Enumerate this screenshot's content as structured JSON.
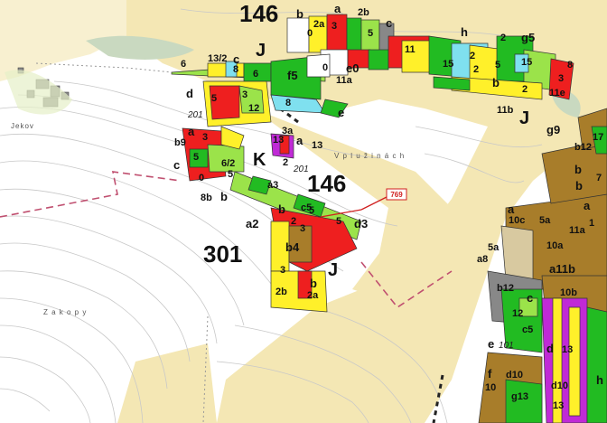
{
  "map": {
    "place_names": {
      "jekov": "Jekov",
      "zakopy": "Z a k o p y",
      "v_pluzinach": "V  p l u ž i n á c h"
    },
    "block_numbers": {
      "b146_top": "146",
      "b146_mid": "146",
      "b301": "301"
    },
    "zone_letters": {
      "j1": "J",
      "j2": "J",
      "j3": "J",
      "k": "K"
    },
    "callout": {
      "value": "769",
      "color": "#d02020"
    },
    "italic_codes": {
      "i201a": "201",
      "i201b": "201",
      "i101": "101"
    },
    "plot_labels": {
      "p_b_top": "b",
      "p_2a": "2a",
      "p_a_top": "a",
      "p_2b_top": "2b",
      "p_c_top": "c",
      "p_0": "0",
      "p_3_top": "3",
      "p_5_top": "5",
      "p_h": "h",
      "p_11": "11",
      "p_2_h": "2",
      "p_g5": "g5",
      "p_2_r": "2",
      "p_6_l": "6",
      "p_13_2": "13/2",
      "p_c_l": "c",
      "p_8_l": "8",
      "p_6_m": "6",
      "p_f5": "f5",
      "p_0_m": "0",
      "p_e0": "e0",
      "p_11a": "11a",
      "p_15a": "15",
      "p_5_r": "5",
      "p_2_r2": "2",
      "p_15b": "15",
      "p_8_r": "8",
      "p_3_r": "3",
      "p_b_r": "b",
      "p_11e": "11e",
      "p_2_r3": "2",
      "p_11b": "11b",
      "p_g9": "g9",
      "p_d_l": "d",
      "p_5_l": "5",
      "p_3_l": "3",
      "p_12": "12",
      "p_8_m": "8",
      "p_e_m": "e",
      "p_b9": "b9",
      "p_a_l": "a",
      "p_3_l2": "3",
      "p_5_l2": "5",
      "p_c_l2": "c",
      "p_6_2": "6/2",
      "p_0_l": "0",
      "p_8b": "8b",
      "p_b_l": "b",
      "p_5_l3": "5",
      "p_3a": "3a",
      "p_13": "13",
      "p_a_m": "a",
      "p_2": "2",
      "p_13_m": "13",
      "p_a3": "a3",
      "p_c5": "c5",
      "p_5_d": "5",
      "p_5_d2": "5",
      "p_d3": "d3",
      "p_a2": "a2",
      "p_b_d": "b",
      "p_2_d": "2",
      "p_3_d": "3",
      "p_b4": "b4",
      "p_3_d2": "3",
      "p_2b": "2b",
      "p_b_d2": "b",
      "p_2a_d": "2a",
      "p_a_e": "a",
      "p_10c": "10c",
      "p_5a": "5a",
      "p_10a": "10a",
      "p_11a_e": "11a",
      "p_a11b": "a11b",
      "p_5a_e": "5a",
      "p_a8": "a8",
      "p_b_e": "b",
      "p_10b": "10b",
      "p_c_e": "c",
      "p_12_e": "12",
      "p_c5_e": "c5",
      "p_b12": "b12",
      "p_13_e": "13",
      "p_d_e": "d",
      "p_e101": "e",
      "p_f10": "f",
      "p_d10": "d10",
      "p_10": "10",
      "p_g13": "g13",
      "p_d10b": "d10",
      "p_13_e2": "13",
      "p_h_e": "h",
      "p_b12_r": "b12",
      "p_17": "17",
      "p_b_ne": "b",
      "p_7": "7",
      "p_a_ne": "a",
      "p_1": "1"
    },
    "colors": {
      "background": "#ffffff",
      "meadow": "#f4e7b4",
      "wet_meadow": "#c9d9c0",
      "forest_dark": "#a87d2a",
      "green": "#22bb22",
      "light_green": "#9be34a",
      "yellow": "#fff02a",
      "red": "#ee1f1f",
      "cyan": "#7fe0ef",
      "magenta": "#c02ad6",
      "olive": "#8aa05a",
      "grey": "#666666",
      "contour": "#c8c8c8"
    }
  }
}
